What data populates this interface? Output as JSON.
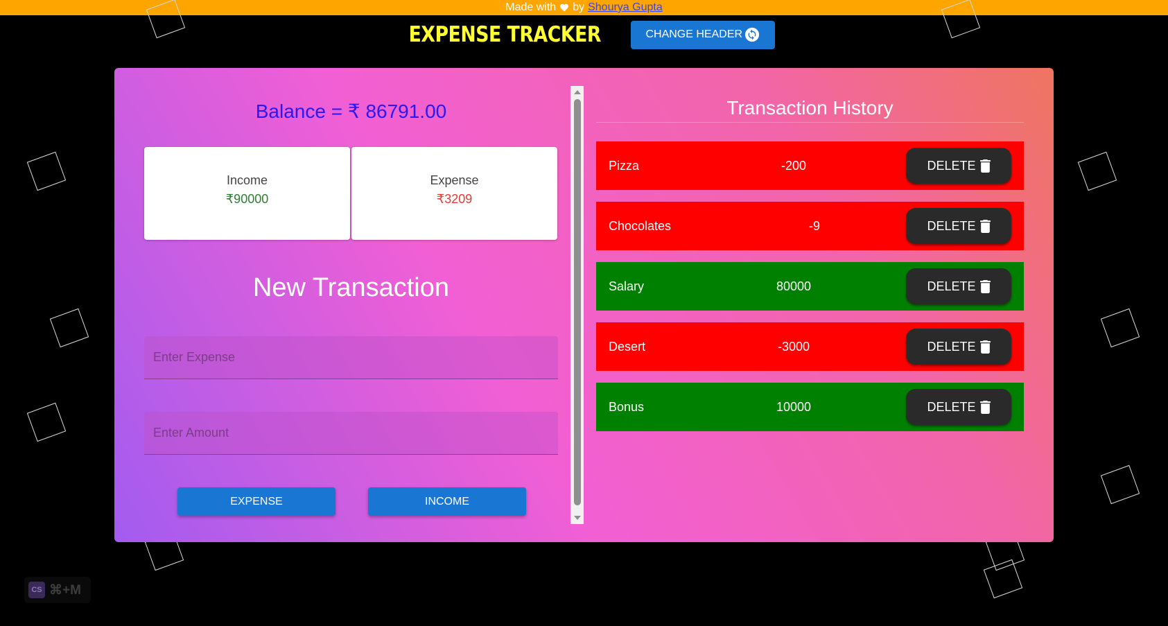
{
  "topbar": {
    "made_with": "Made with",
    "by": "by",
    "author": "Shourya Gupta"
  },
  "header": {
    "title": "EXPENSE TRACKER",
    "change_label": "CHANGE HEADER"
  },
  "summary": {
    "balance": "Balance = ₹ 86791.00",
    "income_label": "Income",
    "income_value": "₹90000",
    "expense_label": "Expense",
    "expense_value": "₹3209"
  },
  "form": {
    "heading": "New Transaction",
    "expense_placeholder": "Enter Expense",
    "amount_placeholder": "Enter Amount",
    "expense_button": "EXPENSE",
    "income_button": "INCOME"
  },
  "history": {
    "title": "Transaction History",
    "delete_label": "DELETE",
    "items": [
      {
        "name": "Pizza",
        "amount": "-200",
        "type": "expense"
      },
      {
        "name": "Chocolates",
        "amount": "-9",
        "type": "expense"
      },
      {
        "name": "Salary",
        "amount": "80000",
        "type": "income"
      },
      {
        "name": "Desert",
        "amount": "-3000",
        "type": "expense"
      },
      {
        "name": "Bonus",
        "amount": "10000",
        "type": "income"
      }
    ]
  },
  "shortcut_badge": {
    "logo": "CS",
    "keys": "⌘+M"
  },
  "colors": {
    "topbar": "#FFA500",
    "title": "#FFFF33",
    "button": "#1976D2",
    "income_row": "#008000",
    "expense_row": "#FF0000",
    "income_text": "#2E7D32",
    "expense_text": "#E53935",
    "balance_text": "#2A18F5"
  },
  "icons": {
    "heart": "heart-icon",
    "refresh": "refresh-icon",
    "delete": "trash-icon"
  }
}
